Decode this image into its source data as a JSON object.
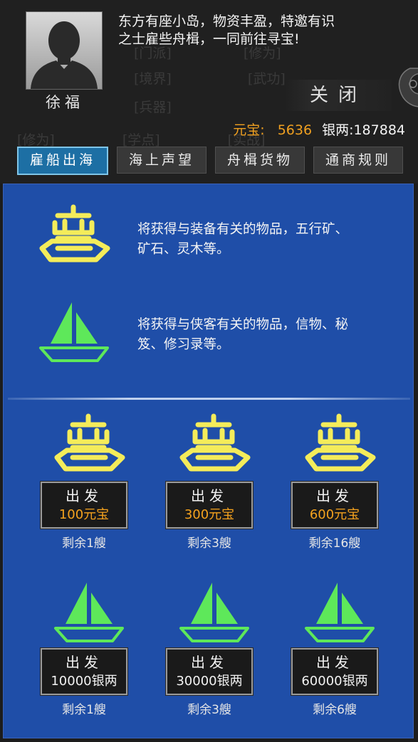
{
  "header": {
    "npc_name": "徐福",
    "intro_line1": "东方有座小岛，物资丰盈，特邀有识",
    "intro_line2": "之士雇些舟楫，一同前往寻宝!",
    "close_label": "关闭",
    "gold_label": "元宝:",
    "gold_value": "5636",
    "silver_label": "银两:",
    "silver_value": "187884"
  },
  "tabs": [
    {
      "label": "雇船出海",
      "active": true
    },
    {
      "label": "海上声望",
      "active": false
    },
    {
      "label": "舟楫货物",
      "active": false
    },
    {
      "label": "通商规则",
      "active": false
    }
  ],
  "legend": {
    "gold_ship_desc_line1": "将获得与装备有关的物品，五行矿、",
    "gold_ship_desc_line2": "矿石、灵木等。",
    "silver_ship_desc_line1": "将获得与侠客有关的物品，信物、秘",
    "silver_ship_desc_line2": "笈、修习录等。"
  },
  "voyages": [
    {
      "type": "gold-junk",
      "depart_label": "出发",
      "cost": "100元宝",
      "remaining": "剩余1艘"
    },
    {
      "type": "gold-junk",
      "depart_label": "出发",
      "cost": "300元宝",
      "remaining": "剩余3艘"
    },
    {
      "type": "gold-junk",
      "depart_label": "出发",
      "cost": "600元宝",
      "remaining": "剩余16艘"
    },
    {
      "type": "sailboat",
      "depart_label": "出发",
      "cost": "10000银两",
      "remaining": "剩余1艘"
    },
    {
      "type": "sailboat",
      "depart_label": "出发",
      "cost": "30000银两",
      "remaining": "剩余3艘"
    },
    {
      "type": "sailboat",
      "depart_label": "出发",
      "cost": "60000银两",
      "remaining": "剩余6艘"
    }
  ],
  "colors": {
    "panel_bg": "#1f4ea8",
    "gold_ship": "#f4ec5a",
    "silver_ship": "#5ee85a",
    "gold_text": "#f4a21e",
    "tab_active": "#1d6fa4"
  }
}
